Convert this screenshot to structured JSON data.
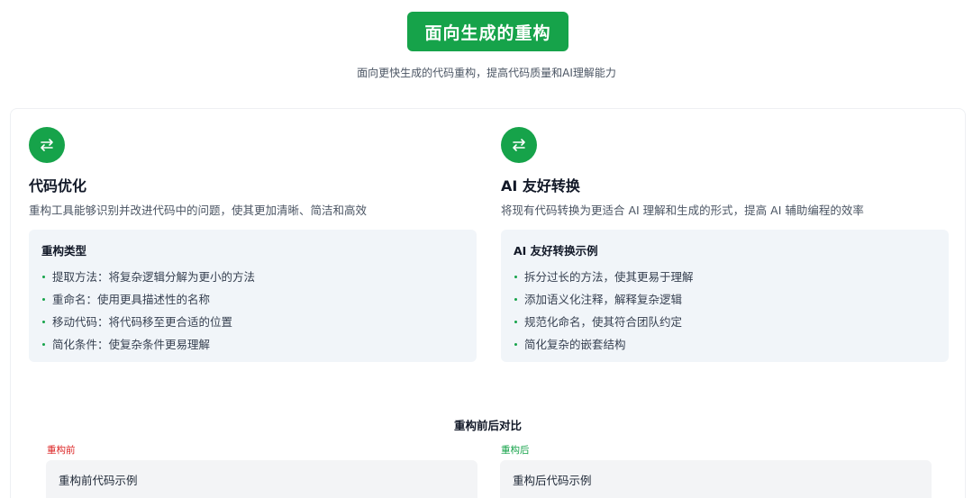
{
  "header": {
    "title": "面向生成的重构",
    "subtitle": "面向更快生成的代码重构，提高代码质量和AI理解能力"
  },
  "left": {
    "title": "代码优化",
    "description": "重构工具能够识别并改进代码中的问题，使其更加清晰、简洁和高效",
    "box_title": "重构类型",
    "items": [
      "提取方法：将复杂逻辑分解为更小的方法",
      "重命名：使用更具描述性的名称",
      "移动代码：将代码移至更合适的位置",
      "简化条件：使复杂条件更易理解"
    ]
  },
  "right": {
    "title": "AI 友好转换",
    "description": "将现有代码转换为更适合 AI 理解和生成的形式，提高 AI 辅助编程的效率",
    "box_title": "AI 友好转换示例",
    "items": [
      "拆分过长的方法，使其更易于理解",
      "添加语义化注释，解释复杂逻辑",
      "规范化命名，使其符合团队约定",
      "简化复杂的嵌套结构"
    ]
  },
  "comparison": {
    "title": "重构前后对比",
    "before_tag": "重构前",
    "after_tag": "重构后",
    "before_header": "重构前代码示例",
    "after_header": "重构后代码示例"
  },
  "colors": {
    "accent": "#16a34a",
    "danger": "#dc2626",
    "panel_bg": "#f1f5f9"
  },
  "icons": {
    "left": "swap-arrows-icon",
    "right": "swap-arrows-icon"
  }
}
